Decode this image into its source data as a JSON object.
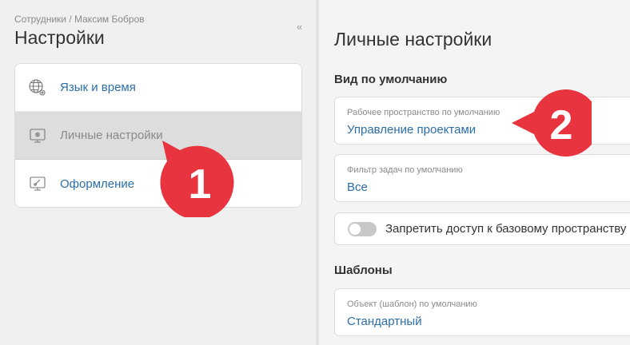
{
  "breadcrumb": "Сотрудники / Максим Бобров",
  "page_title": "Настройки",
  "collapse_glyph": "«",
  "menu": [
    {
      "label": "Язык и время",
      "icon": "globe-gear-icon"
    },
    {
      "label": "Личные настройки",
      "icon": "monitor-gear-icon",
      "selected": true
    },
    {
      "label": "Оформление",
      "icon": "monitor-brush-icon"
    }
  ],
  "right_title": "Личные настройки",
  "section_default_view": "Вид по умолчанию",
  "workspace_field": {
    "label": "Рабочее пространство по умолчанию",
    "value": "Управление проектами"
  },
  "filter_field": {
    "label": "Фильтр задач по умолчанию",
    "value": "Все"
  },
  "toggle": {
    "label": "Запретить доступ к базовому пространству",
    "on": false
  },
  "section_templates": "Шаблоны",
  "template_field": {
    "label": "Объект (шаблон) по умолчанию",
    "value": "Стандартный"
  },
  "callouts": {
    "first": "1",
    "second": "2",
    "color": "#e8343f"
  },
  "colors": {
    "link": "#2b6ea8",
    "selected_bg": "#dddddd"
  }
}
